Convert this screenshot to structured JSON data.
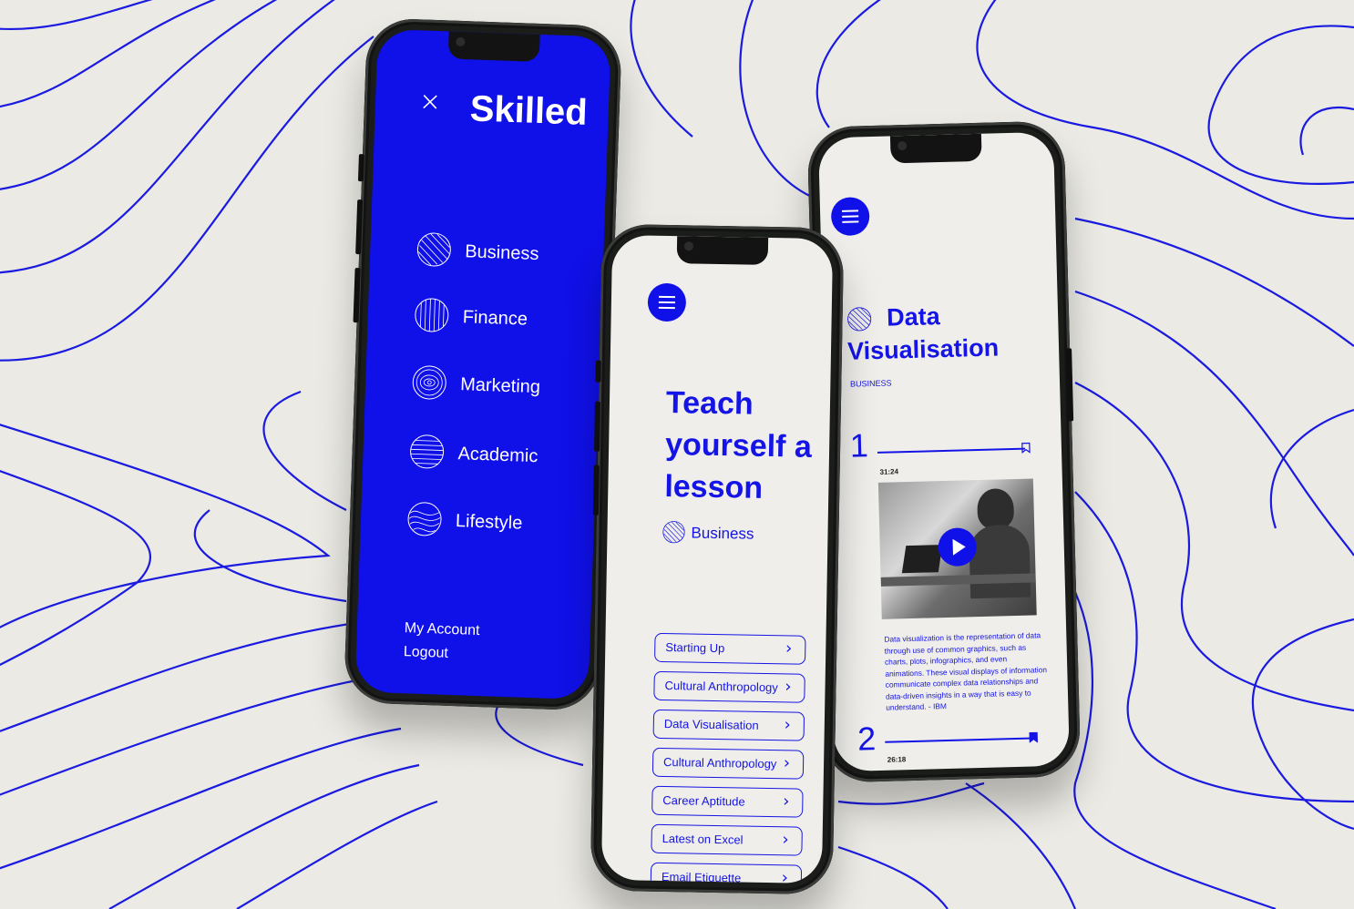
{
  "colors": {
    "brand_blue": "#1010e8",
    "background": "#ebeae4",
    "phone_frame": "#1b1d1b"
  },
  "menu_screen": {
    "close_icon": "close-icon",
    "logo": "Skilled",
    "categories": [
      {
        "label": "Business",
        "icon": "striped-sphere-icon"
      },
      {
        "label": "Finance",
        "icon": "vertical-lined-sphere-icon"
      },
      {
        "label": "Marketing",
        "icon": "swirl-sphere-icon"
      },
      {
        "label": "Academic",
        "icon": "horizontal-lined-sphere-icon"
      },
      {
        "label": "Lifestyle",
        "icon": "wave-sphere-icon"
      }
    ],
    "account_link": "My Account",
    "logout_link": "Logout"
  },
  "lesson_screen": {
    "menu_icon": "hamburger-menu-icon",
    "heading": [
      "Teach",
      "yourself a",
      "lesson"
    ],
    "category": "Business",
    "lessons": [
      "Starting Up",
      "Cultural Anthropology",
      "Data Visualisation",
      "Cultural Anthropology",
      "Career Aptitude",
      "Latest on Excel",
      "Email Etiquette"
    ]
  },
  "detail_screen": {
    "menu_icon": "hamburger-menu-icon",
    "title": [
      "Data",
      "Visualisation"
    ],
    "category_tag": "BUSINESS",
    "lesson_1": {
      "number": "1",
      "duration": "31:24"
    },
    "description": "Data visualization is the representation of data through use of common graphics, such as charts, plots, infographics, and even animations. These visual displays of information communicate complex data relationships and data-driven insights in a way that is easy to understand. - IBM",
    "lesson_2": {
      "number": "2",
      "duration": "26:18"
    }
  }
}
